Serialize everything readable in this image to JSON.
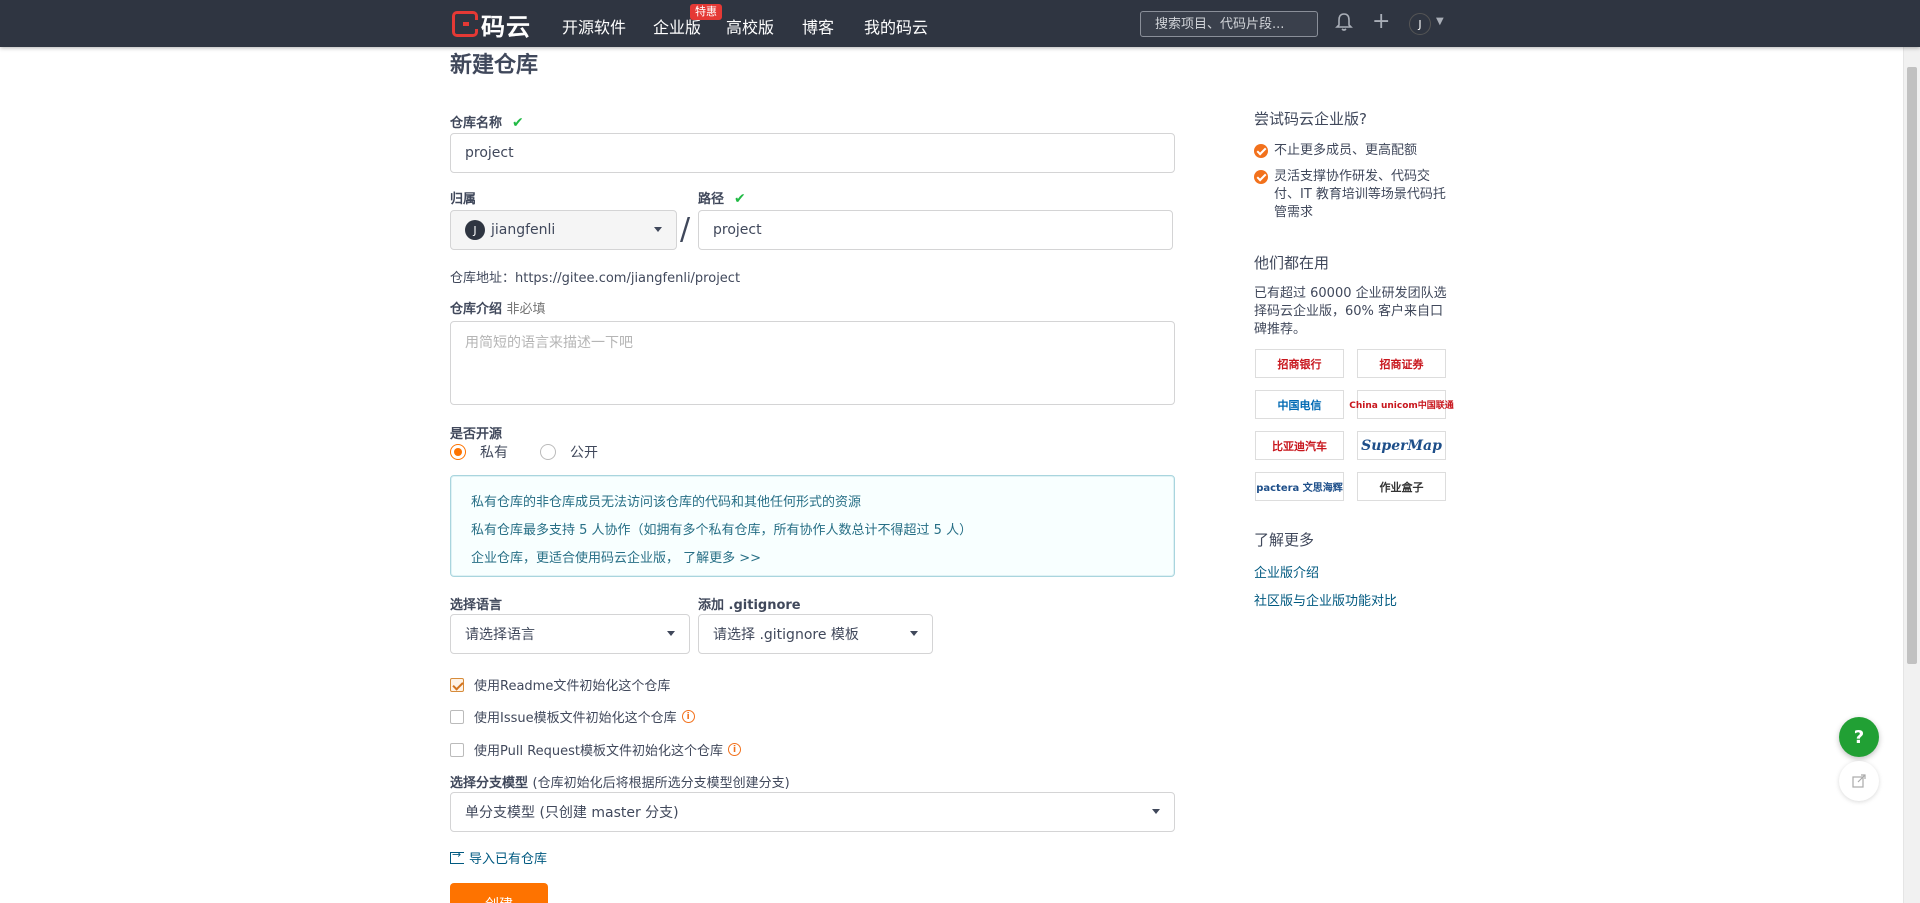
{
  "nav": {
    "logo_text": "码云",
    "items": [
      "开源软件",
      "企业版",
      "高校版",
      "博客",
      "我的码云"
    ],
    "hot_badge": "特惠",
    "search_placeholder": "搜索项目、代码片段...",
    "avatar": "J"
  },
  "form": {
    "title": "新建仓库",
    "repo_name_label": "仓库名称",
    "repo_name_value": "project",
    "owner_label": "归属",
    "owner_value": "jiangfenli",
    "owner_avatar": "J",
    "path_label": "路径",
    "path_value": "project",
    "repo_url": "仓库地址：https://gitee.com/jiangfenli/project",
    "intro_label": "仓库介绍",
    "intro_optional": "非必填",
    "intro_placeholder": "用简短的语言来描述一下吧",
    "open_label": "是否开源",
    "radio_private": "私有",
    "radio_public": "公开",
    "info_lines": [
      "私有仓库的非仓库成员无法访问该仓库的代码和其他任何形式的资源",
      "私有仓库最多支持 5 人协作（如拥有多个私有仓库，所有协作人数总计不得超过 5 人）",
      "企业仓库，更适合使用码云企业版，",
      "了解更多 >>"
    ],
    "lang_label": "选择语言",
    "lang_value": "请选择语言",
    "gitignore_label": "添加 .gitignore",
    "gitignore_value": "请选择 .gitignore 模板",
    "cb_readme": "使用Readme文件初始化这个仓库",
    "cb_issue": "使用Issue模板文件初始化这个仓库",
    "cb_pr": "使用Pull Request模板文件初始化这个仓库",
    "branch_label": "选择分支模型",
    "branch_hint": "(仓库初始化后将根据所选分支模型创建分支)",
    "branch_value": "单分支模型 (只创建 master 分支)",
    "import_text": "导入已有仓库",
    "create_button": "创建"
  },
  "sidebar": {
    "try_title": "尝试码云企业版?",
    "try_points": [
      "不止更多成员、更高配额",
      "灵活支撑协作研发、代码交付、IT 教育培训等场景代码托管需求"
    ],
    "using_title": "他们都在用",
    "using_text": "已有超过 60000 企业研发团队选择码云企业版，60% 客户来自口碑推荐。",
    "logos": [
      "招商银行",
      "招商证券",
      "中国电信",
      "China unicom中国联通",
      "比亚迪汽车",
      "SuperMap",
      "pactera 文思海辉",
      "作业盒子"
    ],
    "more_title": "了解更多",
    "links": [
      "企业版介绍",
      "社区版与企业版功能对比"
    ]
  },
  "colors": {
    "nav_bg": "#2f3541",
    "accent": "#fe7300",
    "success": "#21ba45",
    "info_text": "#276f86",
    "link": "#005980"
  }
}
